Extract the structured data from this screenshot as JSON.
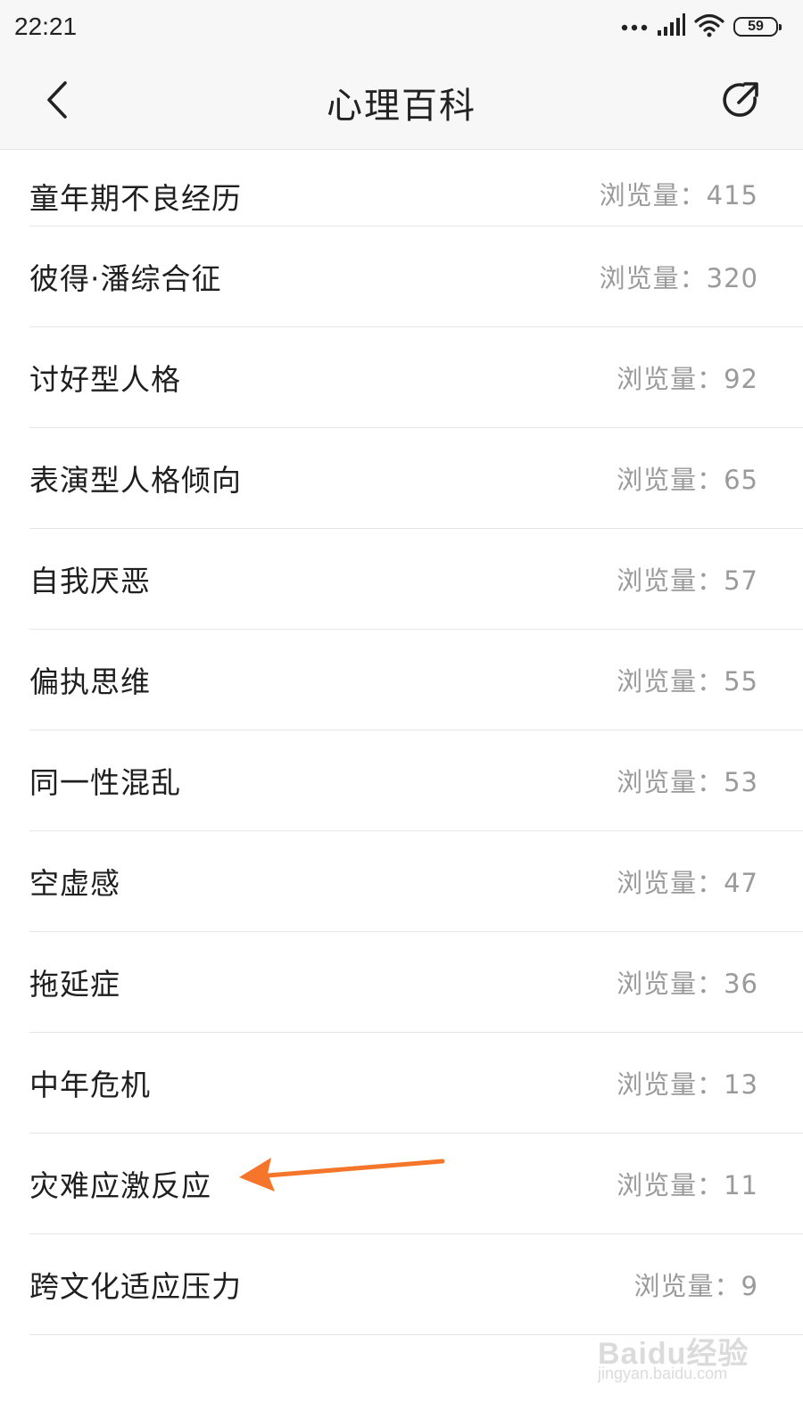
{
  "status_bar": {
    "time": "22:21",
    "battery": "59",
    "icons": [
      "more-dots-icon",
      "signal-icon",
      "wifi-icon",
      "battery-icon"
    ]
  },
  "nav": {
    "title": "心理百科",
    "back_icon": "chevron-left-icon",
    "share_icon": "share-icon"
  },
  "list": {
    "views_label": "浏览量：",
    "items": [
      {
        "title": "童年期不良经历",
        "views": "415"
      },
      {
        "title": "彼得·潘综合征",
        "views": "320"
      },
      {
        "title": "讨好型人格",
        "views": "92"
      },
      {
        "title": "表演型人格倾向",
        "views": "65"
      },
      {
        "title": "自我厌恶",
        "views": "57"
      },
      {
        "title": "偏执思维",
        "views": "55"
      },
      {
        "title": "同一性混乱",
        "views": "53"
      },
      {
        "title": "空虚感",
        "views": "47"
      },
      {
        "title": "拖延症",
        "views": "36"
      },
      {
        "title": "中年危机",
        "views": "13"
      },
      {
        "title": "灾难应激反应",
        "views": "11"
      },
      {
        "title": "跨文化适应压力",
        "views": "9"
      }
    ]
  },
  "annotation": {
    "color": "#f5762a"
  },
  "watermark": {
    "brand": "Baidu经验",
    "url": "jingyan.baidu.com"
  }
}
